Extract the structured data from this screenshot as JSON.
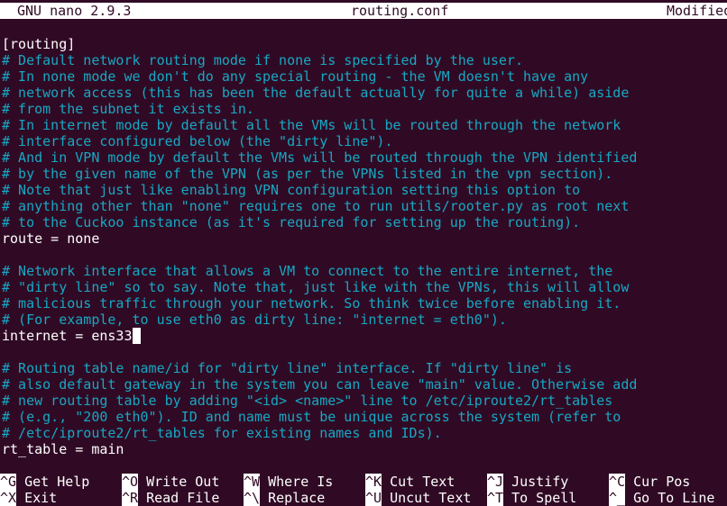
{
  "titlebar": {
    "app": "GNU nano 2.9.3",
    "filename": "routing.conf",
    "status": "Modified"
  },
  "lines": [
    {
      "type": "plain",
      "text": "[routing]"
    },
    {
      "type": "comment",
      "text": "# Default network routing mode if none is specified by the user."
    },
    {
      "type": "comment",
      "text": "# In none mode we don't do any special routing - the VM doesn't have any"
    },
    {
      "type": "comment",
      "text": "# network access (this has been the default actually for quite a while) aside"
    },
    {
      "type": "comment",
      "text": "# from the subnet it exists in."
    },
    {
      "type": "comment",
      "text": "# In internet mode by default all the VMs will be routed through the network"
    },
    {
      "type": "comment",
      "text": "# interface configured below (the \"dirty line\")."
    },
    {
      "type": "comment",
      "text": "# And in VPN mode by default the VMs will be routed through the VPN identified"
    },
    {
      "type": "comment",
      "text": "# by the given name of the VPN (as per the VPNs listed in the vpn section)."
    },
    {
      "type": "comment",
      "text": "# Note that just like enabling VPN configuration setting this option to"
    },
    {
      "type": "comment",
      "text": "# anything other than \"none\" requires one to run utils/rooter.py as root next"
    },
    {
      "type": "comment",
      "text": "# to the Cuckoo instance (as it's required for setting up the routing)."
    },
    {
      "type": "plain",
      "text": "route = none"
    },
    {
      "type": "plain",
      "text": ""
    },
    {
      "type": "comment",
      "text": "# Network interface that allows a VM to connect to the entire internet, the"
    },
    {
      "type": "comment",
      "text": "# \"dirty line\" so to say. Note that, just like with the VPNs, this will allow"
    },
    {
      "type": "comment",
      "text": "# malicious traffic through your network. So think twice before enabling it."
    },
    {
      "type": "comment",
      "text": "# (For example, to use eth0 as dirty line: \"internet = eth0\")."
    },
    {
      "type": "plain",
      "text": "internet = ens33",
      "cursor": true
    },
    {
      "type": "plain",
      "text": ""
    },
    {
      "type": "comment",
      "text": "# Routing table name/id for \"dirty line\" interface. If \"dirty line\" is"
    },
    {
      "type": "comment",
      "text": "# also default gateway in the system you can leave \"main\" value. Otherwise add"
    },
    {
      "type": "comment",
      "text": "# new routing table by adding \"<id> <name>\" line to /etc/iproute2/rt_tables"
    },
    {
      "type": "comment",
      "text": "# (e.g., \"200 eth0\"). ID and name must be unique across the system (refer to"
    },
    {
      "type": "comment",
      "text": "# /etc/iproute2/rt_tables for existing names and IDs)."
    },
    {
      "type": "plain",
      "text": "rt_table = main"
    }
  ],
  "shortcuts": [
    {
      "key": "^G",
      "label": "Get Help",
      "name": "get-help"
    },
    {
      "key": "^O",
      "label": "Write Out",
      "name": "write-out"
    },
    {
      "key": "^W",
      "label": "Where Is",
      "name": "where-is"
    },
    {
      "key": "^K",
      "label": "Cut Text",
      "name": "cut-text"
    },
    {
      "key": "^J",
      "label": "Justify",
      "name": "justify"
    },
    {
      "key": "^C",
      "label": "Cur Pos",
      "name": "cur-pos"
    },
    {
      "key": "^X",
      "label": "Exit",
      "name": "exit"
    },
    {
      "key": "^R",
      "label": "Read File",
      "name": "read-file"
    },
    {
      "key": "^\\",
      "label": "Replace",
      "name": "replace"
    },
    {
      "key": "^U",
      "label": "Uncut Text",
      "name": "uncut-text"
    },
    {
      "key": "^T",
      "label": "To Spell",
      "name": "to-spell"
    },
    {
      "key": "^_",
      "label": "Go To Line",
      "name": "go-to-line"
    }
  ],
  "colors": {
    "background": "#300a24",
    "comment": "#17a8c4",
    "text": "#ffffff"
  }
}
